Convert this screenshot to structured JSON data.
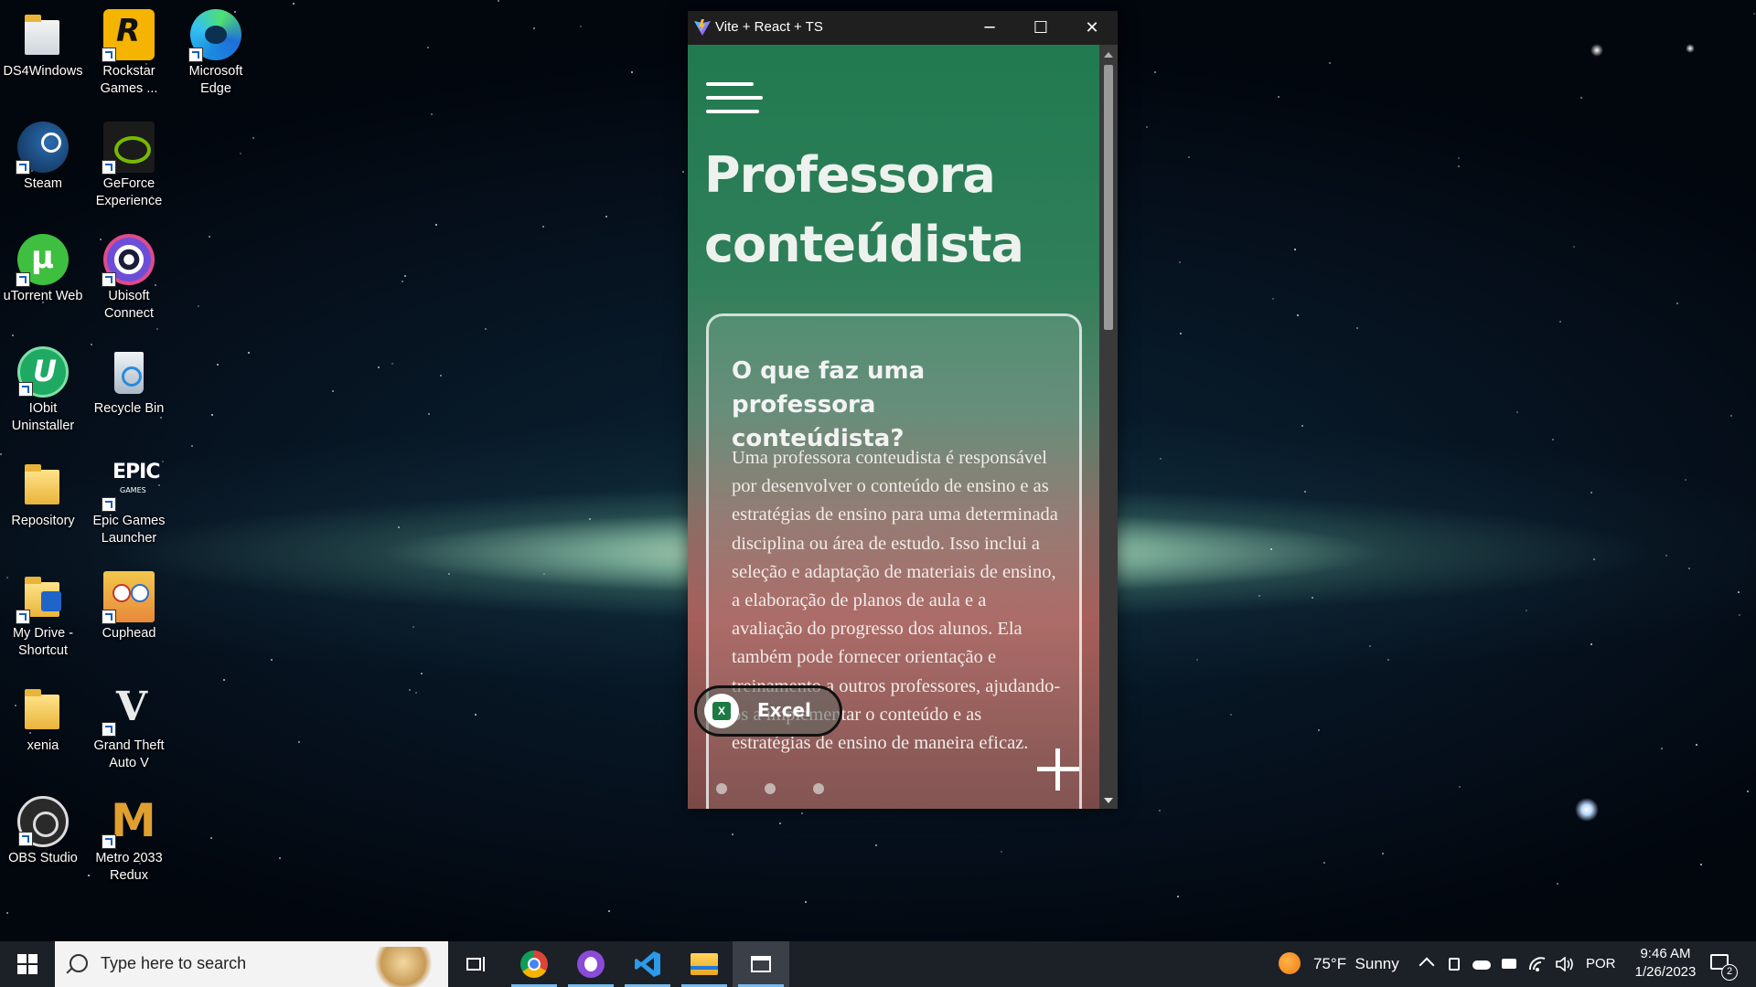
{
  "desktop": {
    "icons": [
      {
        "label": "DS4Windows",
        "icon": "ds4windows-icon"
      },
      {
        "label": "Rockstar Games ...",
        "icon": "rockstar-icon"
      },
      {
        "label": "Microsoft Edge",
        "icon": "edge-icon"
      },
      {
        "label": "Steam",
        "icon": "steam-icon"
      },
      {
        "label": "GeForce Experience",
        "icon": "geforce-icon"
      },
      {
        "label": "uTorrent Web",
        "icon": "utorrent-icon"
      },
      {
        "label": "Ubisoft Connect",
        "icon": "ubisoft-icon"
      },
      {
        "label": "IObit Uninstaller",
        "icon": "iobit-icon"
      },
      {
        "label": "Recycle Bin",
        "icon": "recycle-bin-icon"
      },
      {
        "label": "Repository",
        "icon": "folder-icon"
      },
      {
        "label": "Epic Games Launcher",
        "icon": "epic-games-icon"
      },
      {
        "label": "My Drive - Shortcut",
        "icon": "google-drive-folder-icon"
      },
      {
        "label": "Cuphead",
        "icon": "cuphead-icon"
      },
      {
        "label": "xenia",
        "icon": "folder-icon"
      },
      {
        "label": "Grand Theft Auto V",
        "icon": "gta-v-icon"
      },
      {
        "label": "OBS Studio",
        "icon": "obs-icon"
      },
      {
        "label": "Metro 2033 Redux",
        "icon": "metro-icon"
      }
    ],
    "glyphs": {
      "rockstar": "R",
      "epic": "EPIC",
      "epic_sub": "GAMES",
      "gta": "V",
      "metro": "M",
      "iobit": "U"
    }
  },
  "window": {
    "title": "Vite + React + TS",
    "controls": {
      "minimize": "─",
      "maximize": "☐",
      "close": "✕"
    }
  },
  "page": {
    "hero_line1": "Professora",
    "hero_line2": "conteúdista",
    "card": {
      "heading": "O que faz uma professora conteúdista?",
      "body": "Uma professora conteudista é responsável por desenvolver o conteúdo de ensino e as estratégias de ensino para uma determinada disciplina ou área de estudo. Isso inclui a seleção e adaptação de materiais de ensino, a elaboração de planos de aula e a avaliação do progresso dos alunos. Ela também pode fornecer orientação e treinamento a outros professores, ajudando-os a implementar o conteúdo e as estratégias de ensino de maneira eficaz."
    },
    "badge_label": "Excel",
    "badge_glyph": "X"
  },
  "taskbar": {
    "search_placeholder": "Type here to search",
    "apps": [
      "chrome-icon",
      "github-desktop-icon",
      "vscode-icon",
      "file-explorer-icon",
      "app-window-icon"
    ],
    "weather": "75°F  Sunny",
    "language": "POR",
    "time": "9:46 AM",
    "date": "1/26/2023",
    "notifications": "2"
  },
  "colors": {
    "window_bg": "#1f1f1f",
    "card_border": "#ffffff",
    "excel_green": "#1e7a44",
    "taskbar": "#1c2027",
    "accent": "#76b9ed"
  }
}
